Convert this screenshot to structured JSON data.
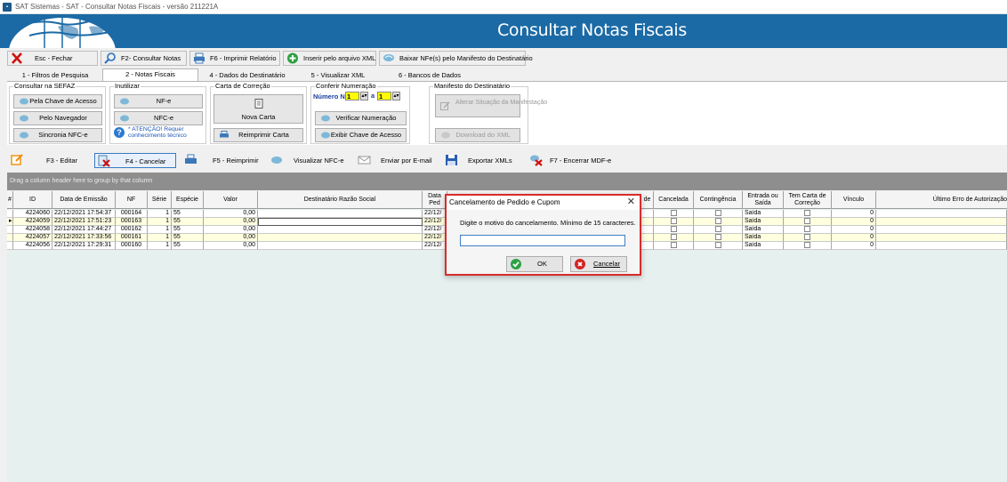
{
  "window": {
    "title": "SAT Sistemas - SAT - Consultar Notas Fiscais - versão 211221A"
  },
  "header": {
    "title": "Consultar Notas Fiscais"
  },
  "toolbar": [
    {
      "label": "Esc - Fechar",
      "icon": "close-icon"
    },
    {
      "label": "F2- Consultar Notas",
      "icon": "search-icon"
    },
    {
      "label": "F6 - Imprimir Relatório",
      "icon": "printer-icon"
    },
    {
      "label": "Inserir pelo arquivo XML",
      "icon": "plus-icon"
    },
    {
      "label": "Baixar NFe(s) pelo Manifesto do Destinatário",
      "icon": "download-icon"
    }
  ],
  "tabs": [
    "1 - Filtros de Pesquisa",
    "2 - Notas Fiscais",
    "4 - Dados do Destinatário",
    "5 - Visualizar XML",
    "6 - Bancos de Dados"
  ],
  "panel": {
    "sefaz": {
      "legend": "Consultar na SEFAZ",
      "buttons": [
        "Pela Chave de Acesso",
        "Pelo Navegador",
        "Sincronia NFC-e"
      ]
    },
    "inutilizar": {
      "legend": "Inutilizar",
      "buttons": [
        "NF-e",
        "NFC-e"
      ],
      "warning": "* ATENÇÃO! Requer conhecimento técnico"
    },
    "correcao": {
      "legend": "Carta de Correção",
      "buttons": [
        "Nova Carta",
        "Reimprimir Carta"
      ]
    },
    "numeracao": {
      "legend": "Conferir Numeração",
      "label": "Número NF",
      "from": "1",
      "to_label": "a",
      "to": "1",
      "buttons": [
        "Verificar Numeração",
        "Exibir Chave de Acesso"
      ]
    },
    "manifesto": {
      "legend": "Manifesto do Destinatário",
      "buttons": [
        "Alterar Situação da Manifestação",
        "Download do XML"
      ]
    }
  },
  "actions": [
    {
      "label": "F3 - Editar"
    },
    {
      "label": "F4 - Cancelar"
    },
    {
      "label": "F5 - Reimprimir"
    },
    {
      "label": "Visualizar NFC-e"
    },
    {
      "label": "Enviar por E-mail"
    },
    {
      "label": "Exportar XMLs"
    },
    {
      "label": "F7 - Encerrar MDF-e"
    }
  ],
  "grid": {
    "group_hint": "Drag a column header here to group by that column",
    "columns": {
      "marker": "#",
      "id": "ID",
      "emissao": "Data de Emissão",
      "nf": "NF",
      "serie": "Série",
      "especie": "Espécie",
      "valor": "Valor",
      "destinatario": "Destinatário Razão Social",
      "datapedido": "Data Ped",
      "de": "de",
      "cancelada": "Cancelada",
      "contingencia": "Contingência",
      "entrada": "Entrada ou Saída",
      "carta": "Tem Carta de Correção",
      "vinculo": "Vínculo",
      "erro": "Último Erro de Autorização"
    },
    "rows": [
      {
        "id": "4224060",
        "emissao": "22/12/2021 17:54:37",
        "nf": "000164",
        "serie": "1",
        "especie": "55",
        "valor": "0,00",
        "datapedido": "22/12/",
        "entrada": "Saída",
        "vinculo": "0"
      },
      {
        "id": "4224059",
        "emissao": "22/12/2021 17:51:23",
        "nf": "000163",
        "serie": "1",
        "especie": "55",
        "valor": "0,00",
        "datapedido": "22/12/",
        "entrada": "Saída",
        "vinculo": "0"
      },
      {
        "id": "4224058",
        "emissao": "22/12/2021 17:44:27",
        "nf": "000162",
        "serie": "1",
        "especie": "55",
        "valor": "0,00",
        "datapedido": "22/12/",
        "entrada": "Saída",
        "vinculo": "0"
      },
      {
        "id": "4224057",
        "emissao": "22/12/2021 17:33:56",
        "nf": "000161",
        "serie": "1",
        "especie": "55",
        "valor": "0,00",
        "datapedido": "22/12/",
        "entrada": "Saída",
        "vinculo": "0"
      },
      {
        "id": "4224056",
        "emissao": "22/12/2021 17:29:31",
        "nf": "000160",
        "serie": "1",
        "especie": "55",
        "valor": "0,00",
        "datapedido": "22/12/",
        "entrada": "Saída",
        "vinculo": "0"
      }
    ]
  },
  "dialog": {
    "title": "Cancelamento de Pedido e Cupom",
    "message": "Digite o motivo do cancelamento. Mínimo de 15 caracteres.",
    "input_value": "",
    "ok": "OK",
    "cancel": "Cancelar"
  },
  "colors": {
    "header": "#1b6aa5",
    "dialog_border": "#d92b2b",
    "highlight_field": "#ffff00",
    "row_alt": "#ffffe0"
  }
}
